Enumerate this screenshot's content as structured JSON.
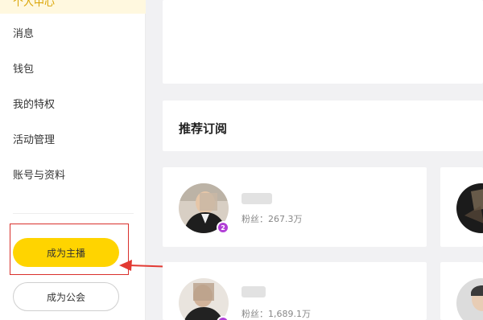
{
  "sidebar": {
    "top_item_partial": "个人中心",
    "items": [
      {
        "label": "消息"
      },
      {
        "label": "钱包"
      },
      {
        "label": "我的特权"
      },
      {
        "label": "活动管理"
      },
      {
        "label": "账号与资料"
      }
    ],
    "become_anchor_label": "成为主播",
    "become_guild_label": "成为公会"
  },
  "recommend": {
    "title": "推荐订阅",
    "streamers": [
      {
        "fans": "粉丝：267.3万",
        "level": "2"
      },
      {
        "fans": "粉丝：1,689.1万",
        "level": ""
      }
    ]
  },
  "colors": {
    "accent": "#ffd400",
    "highlight": "#d9302c",
    "badge": "#b13fd6"
  }
}
